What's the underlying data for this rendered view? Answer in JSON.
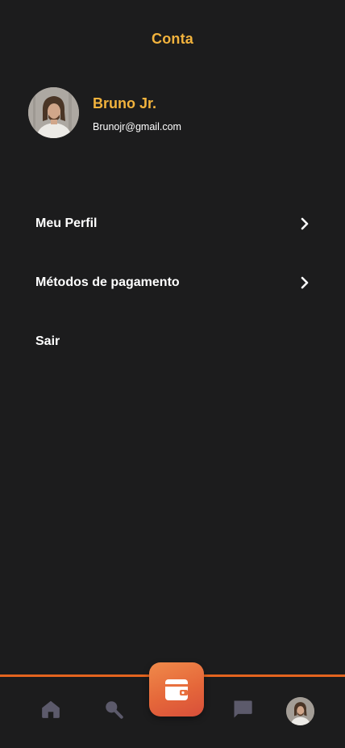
{
  "header": {
    "title": "Conta"
  },
  "profile": {
    "name": "Bruno Jr.",
    "email": "Brunojr@gmail.com"
  },
  "menu": {
    "items": [
      {
        "label": "Meu Perfil",
        "has_chevron": true
      },
      {
        "label": "Métodos de pagamento",
        "has_chevron": true
      },
      {
        "label": "Sair",
        "has_chevron": false
      }
    ]
  },
  "bottom_nav": {
    "items": [
      {
        "icon": "home-icon",
        "active": false
      },
      {
        "icon": "search-icon",
        "active": false
      },
      {
        "icon": "wallet-icon",
        "active": true
      },
      {
        "icon": "chat-icon",
        "active": false
      },
      {
        "icon": "profile-avatar",
        "active": false
      }
    ]
  },
  "colors": {
    "background": "#1c1c1d",
    "accent_yellow": "#f2b33d",
    "accent_orange": "#e4641f",
    "icon_inactive": "#5c5a6b",
    "text": "#ffffff"
  }
}
